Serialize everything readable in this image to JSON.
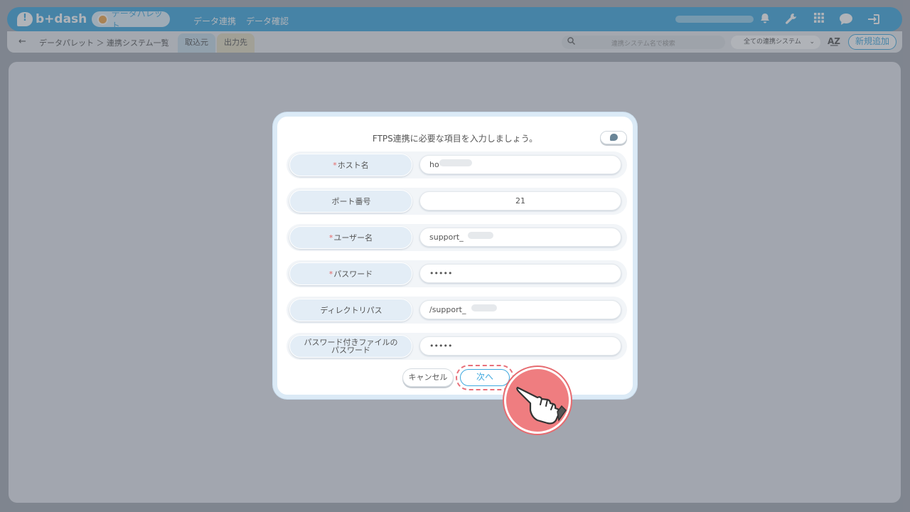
{
  "header": {
    "logo_text": "b+dash",
    "active_app": "データパレット",
    "nav": [
      "データ連携",
      "データ確認"
    ],
    "icons": [
      "bell-icon",
      "wrench-icon",
      "apps-grid-icon",
      "chat-icon",
      "logout-icon"
    ],
    "accent_color": "#3ea8de"
  },
  "subbar": {
    "breadcrumb": "データパレット ＞ 連携システム一覧",
    "tab_import": "取込元",
    "tab_export": "出力先",
    "search_placeholder": "連携システム名で検索",
    "filter_value": "全ての連携システム",
    "add_button": "新規追加"
  },
  "modal": {
    "title": "FTPS連携に必要な項目を入力しましょう。",
    "fields": [
      {
        "label": "ホスト名",
        "required": "*",
        "value": "ho"
      },
      {
        "label": "ポート番号",
        "required": "",
        "value": "21"
      },
      {
        "label": "ユーザー名",
        "required": "*",
        "value": "support_"
      },
      {
        "label": "パスワード",
        "required": "*",
        "value": "•••••"
      },
      {
        "label": "ディレクトリパス",
        "required": "",
        "value": "/support_"
      },
      {
        "label_line1": "パスワード付きファイルの",
        "label_line2": "パスワード",
        "required": "",
        "value": "•••••"
      }
    ],
    "cancel_button": "キャンセル",
    "next_button": "次へ"
  }
}
